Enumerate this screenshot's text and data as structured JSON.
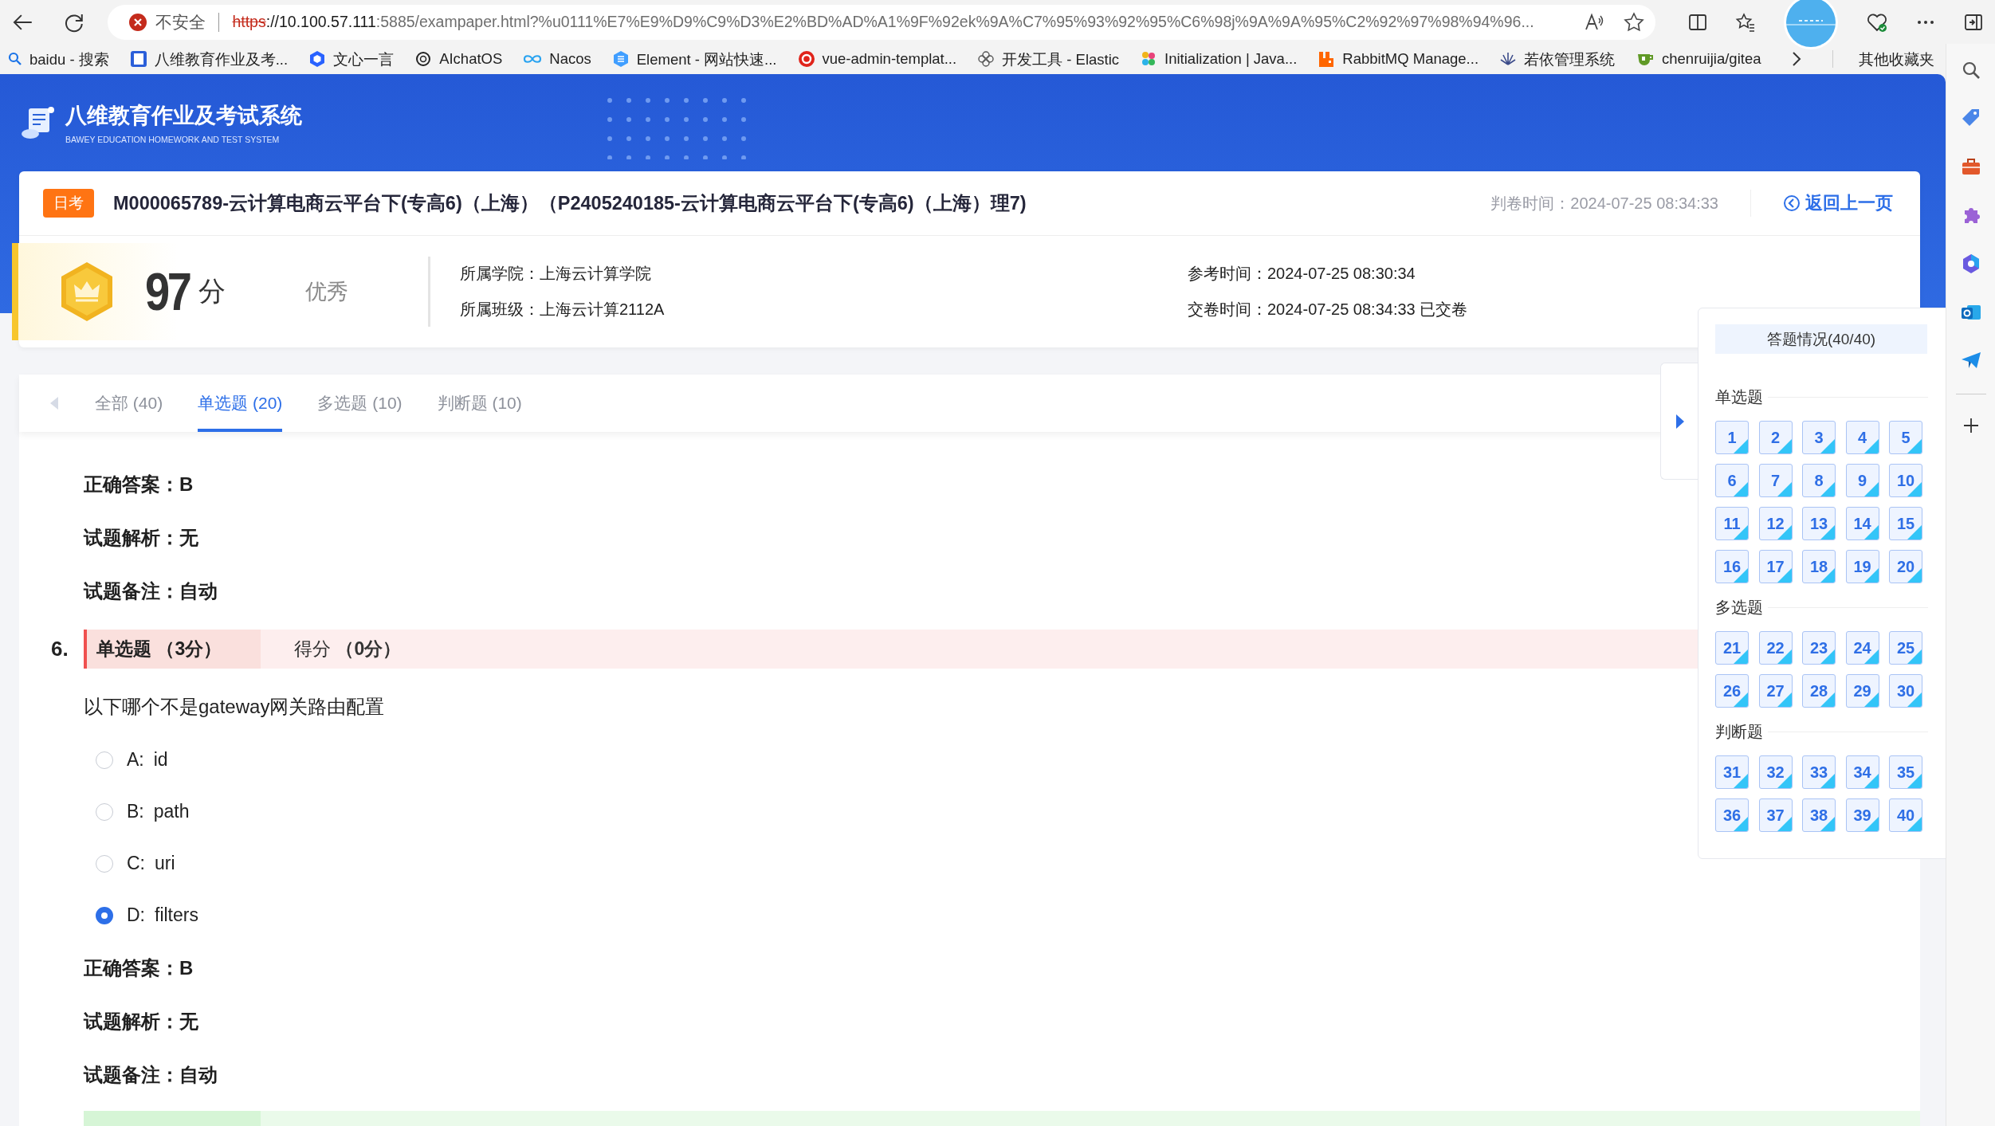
{
  "browser": {
    "address": {
      "security": "不安全",
      "scheme": "https",
      "host": "://10.100.57.111",
      "path": ":5885/exampaper.html?%u0111%E7%E9%D9%C9%D3%E2%BD%AD%A1%9F%92ek%9A%C7%95%93%92%95%C6%98j%9A%9A%95%C2%92%97%98%94%96..."
    },
    "bookmarks": [
      {
        "label": "baidu - 搜索"
      },
      {
        "label": "八维教育作业及考..."
      },
      {
        "label": "文心一言"
      },
      {
        "label": "AIchatOS"
      },
      {
        "label": "Nacos"
      },
      {
        "label": "Element - 网站快速..."
      },
      {
        "label": "vue-admin-templat..."
      },
      {
        "label": "开发工具 - Elastic"
      },
      {
        "label": "Initialization | Java..."
      },
      {
        "label": "RabbitMQ Manage..."
      },
      {
        "label": "若依管理系统"
      },
      {
        "label": "chenruijia/gitea"
      }
    ],
    "more_bookmarks": "其他收藏夹"
  },
  "app": {
    "title": "八维教育作业及考试系统",
    "subtitle": "BAWEY EDUCATION HOMEWORK AND TEST SYSTEM"
  },
  "exam": {
    "badge": "日考",
    "title": "M000065789-云计算电商云平台下(专高6)（上海）（P2405240185-云计算电商云平台下(专高6)（上海）理7)",
    "graded_time": "判卷时间：2024-07-25 08:34:33",
    "back_link": "返回上一页",
    "score": "97",
    "score_unit": "分",
    "grade": "优秀",
    "info": [
      [
        "所属学院：上海云计算学院",
        "所属班级：上海云计算2112A"
      ],
      [
        "参考时间：2024-07-25 08:30:34",
        "交卷时间：2024-07-25 08:34:33 已交卷"
      ]
    ]
  },
  "tabs": [
    {
      "label": "全部 (40)",
      "selected": false
    },
    {
      "label": "单选题 (20)",
      "selected": true
    },
    {
      "label": "多选题 (10)",
      "selected": false
    },
    {
      "label": "判断题 (10)",
      "selected": false
    }
  ],
  "sections": [
    {
      "kind": "details",
      "lines": [
        "正确答案：B",
        "试题解析：无",
        "试题备注：自动"
      ]
    },
    {
      "kind": "question",
      "number": "6.",
      "correct": false,
      "type": "单选题 （3分）",
      "score": "得分 **（0分）**",
      "text": "以下哪个不是gateway网关路由配置",
      "options": [
        {
          "letter": "A:",
          "text": "id",
          "selected": false
        },
        {
          "letter": "B:",
          "text": "path",
          "selected": false
        },
        {
          "letter": "C:",
          "text": "uri",
          "selected": false
        },
        {
          "letter": "D:",
          "text": "filters",
          "selected": true
        }
      ]
    },
    {
      "kind": "details",
      "lines": [
        "正确答案：B",
        "试题解析：无",
        "试题备注：自动"
      ]
    },
    {
      "kind": "question_start",
      "correct": true
    }
  ],
  "answer_panel": {
    "summary": "答题情况(40/40)",
    "groups": [
      {
        "title": "单选题",
        "items": [
          {
            "label": "1",
            "answered": true
          },
          {
            "label": "2",
            "answered": true
          },
          {
            "label": "3",
            "answered": true
          },
          {
            "label": "4",
            "answered": true
          },
          {
            "label": "5",
            "answered": true
          },
          {
            "label": "6",
            "answered": true
          },
          {
            "label": "7",
            "answered": true
          },
          {
            "label": "8",
            "answered": true
          },
          {
            "label": "9",
            "answered": true
          },
          {
            "label": "10",
            "answered": true
          },
          {
            "label": "11",
            "answered": true
          },
          {
            "label": "12",
            "answered": true
          },
          {
            "label": "13",
            "answered": true
          },
          {
            "label": "14",
            "answered": true
          },
          {
            "label": "15",
            "answered": true
          },
          {
            "label": "16",
            "answered": true
          },
          {
            "label": "17",
            "answered": true
          },
          {
            "label": "18",
            "answered": true
          },
          {
            "label": "19",
            "answered": true
          },
          {
            "label": "20",
            "answered": true
          }
        ]
      },
      {
        "title": "多选题",
        "items": [
          {
            "label": "21",
            "answered": true
          },
          {
            "label": "22",
            "answered": true
          },
          {
            "label": "23",
            "answered": true
          },
          {
            "label": "24",
            "answered": true
          },
          {
            "label": "25",
            "answered": true
          },
          {
            "label": "26",
            "answered": true
          },
          {
            "label": "27",
            "answered": true
          },
          {
            "label": "28",
            "answered": true
          },
          {
            "label": "29",
            "answered": true
          },
          {
            "label": "30",
            "answered": true
          }
        ]
      },
      {
        "title": "判断题",
        "items": [
          {
            "label": "31",
            "answered": true
          },
          {
            "label": "32",
            "answered": true
          },
          {
            "label": "33",
            "answered": true
          },
          {
            "label": "34",
            "answered": true
          },
          {
            "label": "35",
            "answered": true
          },
          {
            "label": "36",
            "answered": true
          },
          {
            "label": "37",
            "answered": true
          },
          {
            "label": "38",
            "answered": true
          },
          {
            "label": "39",
            "answered": true
          },
          {
            "label": "40",
            "answered": true
          }
        ]
      }
    ]
  }
}
